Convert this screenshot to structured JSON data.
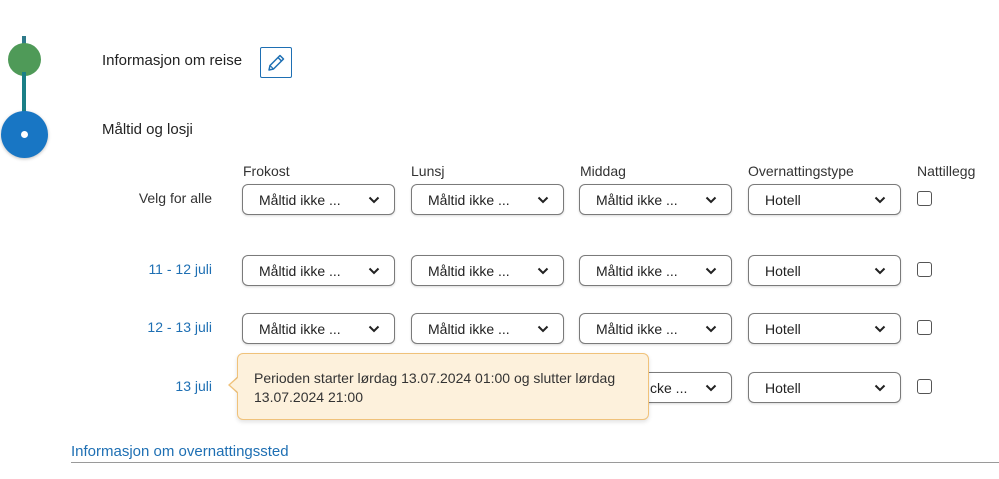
{
  "steps": [
    {
      "title": "Informasjon om reise",
      "state": "completed",
      "color": "#4f9a58"
    },
    {
      "title": "Måltid og losji",
      "state": "active",
      "color": "#1876c4"
    }
  ],
  "columns": [
    "Frokost",
    "Lunsj",
    "Middag",
    "Overnattingstype",
    "Nattillegg"
  ],
  "rows": [
    {
      "label": "Velg for alle",
      "is_link": false,
      "frokost": "Måltid ikke ...",
      "lunsj": "Måltid ikke ...",
      "middag": "Måltid ikke ...",
      "overnatting": "Hotell",
      "nattillegg": false
    },
    {
      "label": "11 - 12 juli",
      "is_link": true,
      "frokost": "Måltid ikke ...",
      "lunsj": "Måltid ikke ...",
      "middag": "Måltid ikke ...",
      "overnatting": "Hotell",
      "nattillegg": false
    },
    {
      "label": "12 - 13 juli",
      "is_link": true,
      "frokost": "Måltid ikke ...",
      "lunsj": "Måltid ikke ...",
      "middag": "Måltid ikke ...",
      "overnatting": "Hotell",
      "nattillegg": false
    },
    {
      "label": "13 juli",
      "is_link": true,
      "frokost": "",
      "lunsj": "",
      "middag": "cke ...",
      "overnatting": "Hotell",
      "nattillegg": false
    }
  ],
  "tooltip": {
    "text": "Perioden starter lørdag 13.07.2024 01:00 og slutter lørdag 13.07.2024 21:00"
  },
  "footer": {
    "section_link": "Informasjon om overnattingssted"
  },
  "colors": {
    "accent": "#1e6fb3",
    "tooltip_bg": "#fdf1dc",
    "tooltip_border": "#f0c27a"
  },
  "icons": {
    "edit": "pencil-icon",
    "dropdown": "chevron-down-icon"
  }
}
